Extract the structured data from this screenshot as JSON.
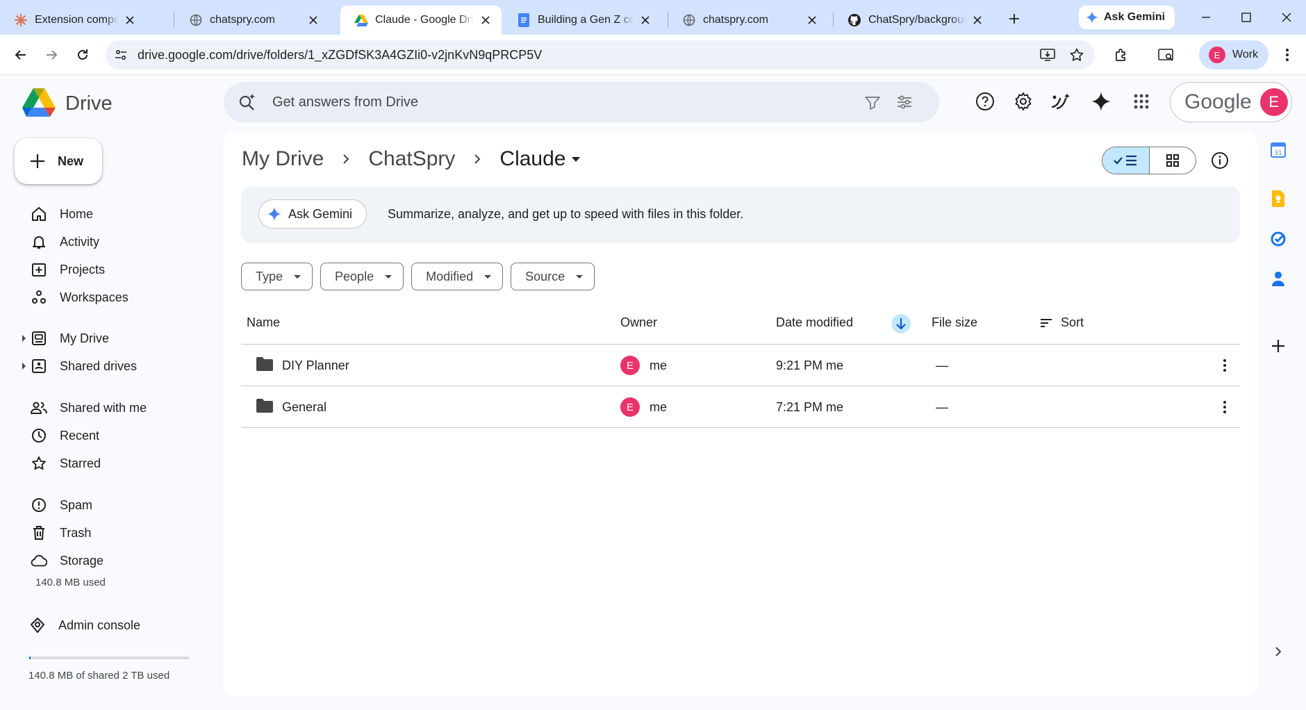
{
  "browser": {
    "tabs": [
      {
        "title": "Extension compatibilit",
        "favicon": "claude-asterisk-icon"
      },
      {
        "title": "chatspry.com",
        "favicon": "globe-icon"
      },
      {
        "title": "Claude - Google Drive",
        "favicon": "google-drive-icon",
        "active": true
      },
      {
        "title": "Building a Gen Z cons",
        "favicon": "google-docs-icon"
      },
      {
        "title": "chatspry.com",
        "favicon": "globe-icon"
      },
      {
        "title": "ChatSpry/background",
        "favicon": "github-icon"
      }
    ],
    "ask_gemini": "Ask Gemini",
    "url": "drive.google.com/drive/folders/1_xZGDfSK3A4GZIi0-v2jnKvN9qPRCP5V",
    "profile": {
      "initial": "E",
      "label": "Work"
    }
  },
  "drive": {
    "app_name": "Drive",
    "search_placeholder": "Get answers from Drive",
    "account": {
      "brand": "Google",
      "initial": "E"
    },
    "new_button": "New",
    "nav": [
      {
        "label": "Home",
        "icon": "home-icon"
      },
      {
        "label": "Activity",
        "icon": "bell-icon"
      },
      {
        "label": "Projects",
        "icon": "projects-icon"
      },
      {
        "label": "Workspaces",
        "icon": "workspaces-icon"
      },
      {
        "label": "My Drive",
        "icon": "my-drive-icon"
      },
      {
        "label": "Shared drives",
        "icon": "shared-drives-icon"
      },
      {
        "label": "Shared with me",
        "icon": "people-icon"
      },
      {
        "label": "Recent",
        "icon": "clock-icon"
      },
      {
        "label": "Starred",
        "icon": "star-icon"
      },
      {
        "label": "Spam",
        "icon": "spam-icon"
      },
      {
        "label": "Trash",
        "icon": "trash-icon"
      },
      {
        "label": "Storage",
        "icon": "cloud-icon"
      },
      {
        "label": "Admin console",
        "icon": "admin-icon"
      }
    ],
    "storage_used": "140.8 MB used",
    "storage_shared": "140.8 MB of shared 2 TB used",
    "storage_fraction": 0.0001,
    "breadcrumb": [
      "My Drive",
      "ChatSpry",
      "Claude"
    ],
    "gemini_banner": {
      "button": "Ask Gemini",
      "text": "Summarize, analyze, and get up to speed with files in this folder."
    },
    "filters": [
      "Type",
      "People",
      "Modified",
      "Source"
    ],
    "columns": {
      "name": "Name",
      "owner": "Owner",
      "date": "Date modified",
      "size": "File size",
      "sort": "Sort"
    },
    "rows": [
      {
        "name": "DIY Planner",
        "owner_initial": "E",
        "owner": "me",
        "modified": "9:21 PM me",
        "size": "—"
      },
      {
        "name": "General",
        "owner_initial": "E",
        "owner": "me",
        "modified": "7:21 PM me",
        "size": "—"
      }
    ]
  },
  "colors": {
    "accent": "#0b57d0",
    "avatar": "#e8336d",
    "chip_selected": "#c2e7ff"
  }
}
